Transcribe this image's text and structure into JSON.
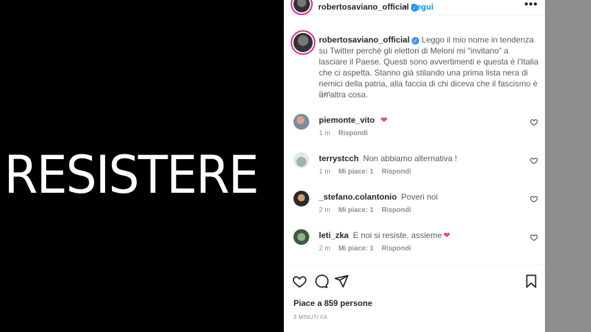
{
  "image": {
    "overlay_text": "RESISTERE"
  },
  "header": {
    "username": "robertosaviano_official",
    "separator": "•",
    "follow_label": "Segui",
    "more_label": "•••"
  },
  "caption": {
    "username": "robertosaviano_official",
    "text": "Leggo il mio nome in tendenza su Twitter perché gli elettori di Meloni mi “invitano” a lasciare il Paese. Questi sono avvertimenti e questa è l’Italia che ci aspetta. Stanno già stilando una prima lista nera di nemici della patria, alla faccia di chi diceva che il fascismo è un’altra cosa.",
    "time": "3 m"
  },
  "comments": [
    {
      "username": "piemonte_vito",
      "text": "",
      "emoji": "❤",
      "time": "1 m",
      "likes": "",
      "reply": "Rispondi"
    },
    {
      "username": "terrystcch",
      "text": "Non abbiamo alternativa !",
      "emoji": "",
      "time": "1 m",
      "likes": "Mi piace: 1",
      "reply": "Rispondi"
    },
    {
      "username": "_stefano.colantonio",
      "text": "Poveri noi",
      "emoji": "",
      "time": "2 m",
      "likes": "Mi piace: 1",
      "reply": "Rispondi"
    },
    {
      "username": "leti_zka",
      "text": "E noi si resiste, assieme",
      "emoji": "❤",
      "time": "2 m",
      "likes": "Mi piace: 1",
      "reply": "Rispondi"
    }
  ],
  "footer": {
    "likes_text": "Piace a 859 persone",
    "posted_text": "3 MINUTI FA"
  },
  "colors": {
    "follow": "#0095f6",
    "verified": "#3897f0",
    "heart": "#ed4956"
  }
}
